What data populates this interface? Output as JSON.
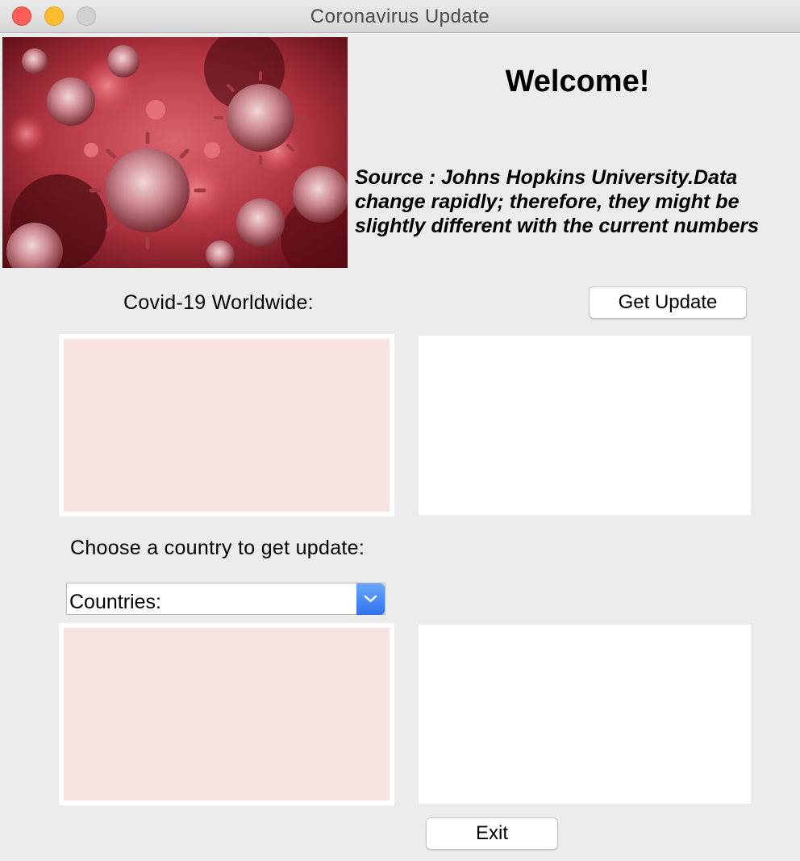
{
  "window": {
    "title": "Coronavirus Update"
  },
  "header": {
    "welcome": "Welcome!",
    "source_lines": [
      "Source : Johns Hopkins University.Data",
      "change rapidly; therefore, they might be",
      "slightly different with the current numbers"
    ]
  },
  "worldwide": {
    "label": "Covid-19 Worldwide:",
    "button": "Get Update"
  },
  "country": {
    "label": "Choose a country to get update:",
    "select_value": "Countries:"
  },
  "footer": {
    "exit_button": "Exit"
  },
  "colors": {
    "panel_pink": "#f8e3e2",
    "background": "#ececec",
    "select_accent": "#2f73ee"
  }
}
